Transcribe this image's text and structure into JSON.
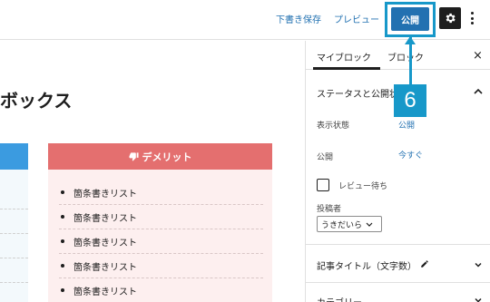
{
  "toolbar": {
    "save_draft_label": "下書き保存",
    "preview_label": "プレビュー",
    "publish_label": "公開",
    "settings_icon": "gear-icon",
    "options_icon": "kebab-icon"
  },
  "editor": {
    "heading": "ボックス",
    "demerit_box": {
      "title": "デメリット",
      "icon": "thumbs-down-icon",
      "items": [
        "箇条書きリスト",
        "箇条書きリスト",
        "箇条書きリスト",
        "箇条書きリスト",
        "箇条書きリスト"
      ]
    }
  },
  "sidebar": {
    "tab_my_block": "マイブロック",
    "tab_block": "ブロック",
    "close_label": "×",
    "status_panel": {
      "title": "ステータスと公開状",
      "visibility_label": "表示状態",
      "visibility_value": "公開",
      "publish_label": "公開",
      "publish_value": "今すぐ",
      "pending_review_label": "レビュー待ち",
      "author_label": "投稿者",
      "author_value": "うきだいら"
    },
    "title_count_panel": "記事タイトル（文字数）",
    "categories_panel": "カテゴリー"
  },
  "annotation": {
    "step_number": "6"
  },
  "colors": {
    "accent": "#2271b1",
    "annotation": "#1798c9",
    "demerit": "#e46f6f",
    "demerit_bg": "#fdefef"
  }
}
